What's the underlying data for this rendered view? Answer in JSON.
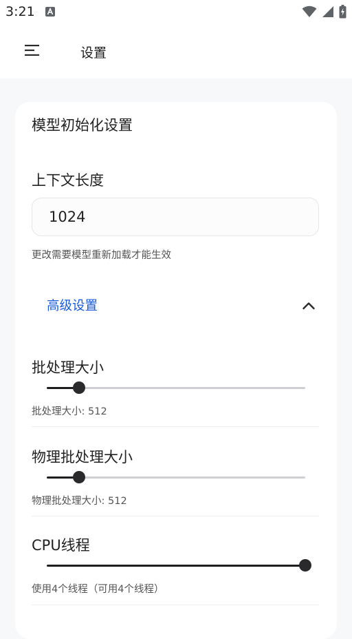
{
  "status_bar": {
    "time": "3:21",
    "icons": [
      "notification-a-icon",
      "wifi-icon",
      "signal-icon",
      "battery-charging-icon"
    ]
  },
  "app_bar": {
    "title": "设置",
    "menu_icon": "menu-icon"
  },
  "model_init": {
    "section_title": "模型初始化设置",
    "context_length": {
      "label": "上下文长度",
      "value": "1024",
      "hint": "更改需要模型重新加载才能生效"
    },
    "advanced": {
      "label": "高级设置",
      "expanded": true,
      "icon": "chevron-up-icon",
      "accent_color": "#1a5bd8"
    },
    "sliders": [
      {
        "title": "批处理大小",
        "caption": "批处理大小: 512",
        "fraction": 0.125
      },
      {
        "title": "物理批处理大小",
        "caption": "物理批处理大小: 512",
        "fraction": 0.125
      },
      {
        "title": "CPU线程",
        "caption": "使用4个线程（可用4个线程）",
        "fraction": 1.0
      }
    ]
  }
}
